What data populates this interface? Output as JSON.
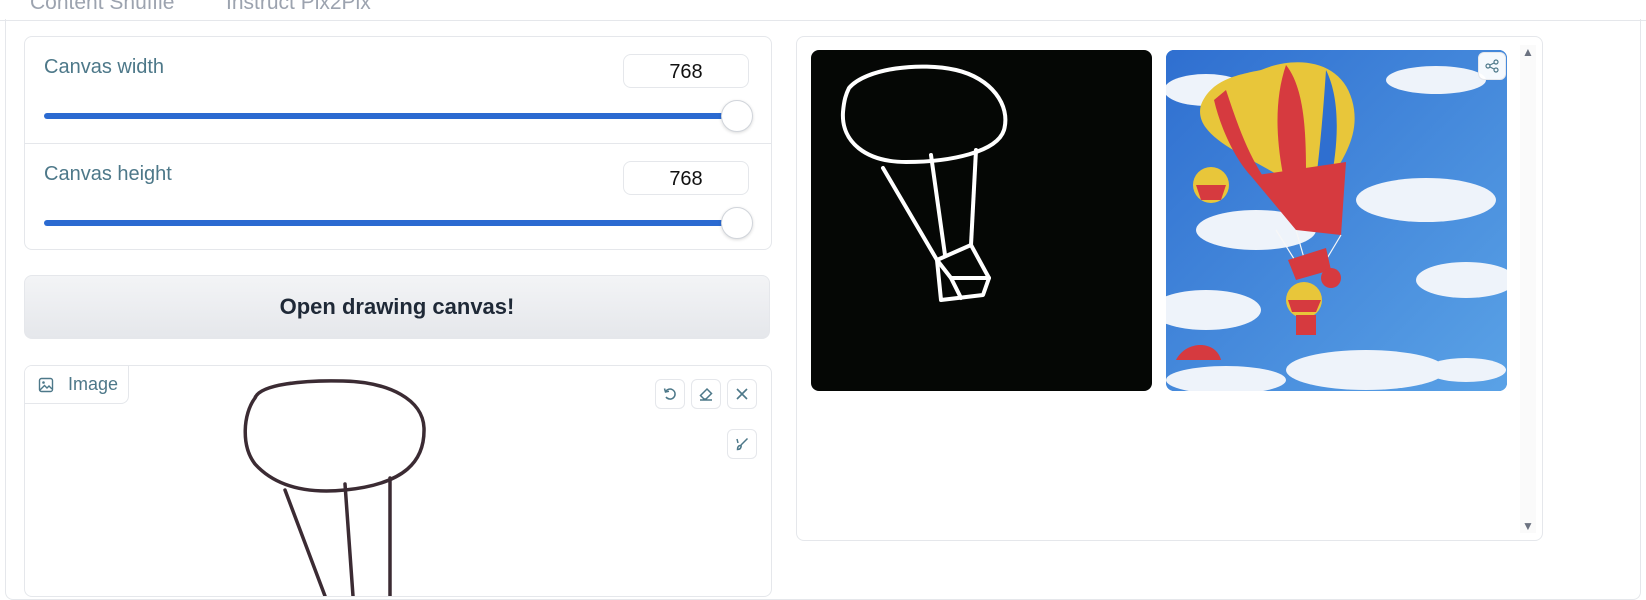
{
  "tabs": [
    "Content Shuffle",
    "Instruct Pix2Pix"
  ],
  "sliders": [
    {
      "label": "Canvas width",
      "value": "768",
      "fraction": 1.0
    },
    {
      "label": "Canvas height",
      "value": "768",
      "fraction": 1.0
    }
  ],
  "open_button": "Open drawing canvas!",
  "image_panel": {
    "label": "Image",
    "tools": [
      "undo-icon",
      "eraser-icon",
      "close-icon",
      "brush-icon"
    ]
  },
  "gallery": {
    "items": [
      "sketch-output",
      "hot-air-balloon-output"
    ],
    "share_icon": "share-icon"
  },
  "colors": {
    "accent": "#2b6ad1",
    "label": "#4d7889",
    "sky": "#3f86d6",
    "cloud": "#eef3fa",
    "balloon_yellow": "#e8c63a",
    "balloon_red": "#d63a3f",
    "balloon_blue": "#2f6fd0"
  }
}
